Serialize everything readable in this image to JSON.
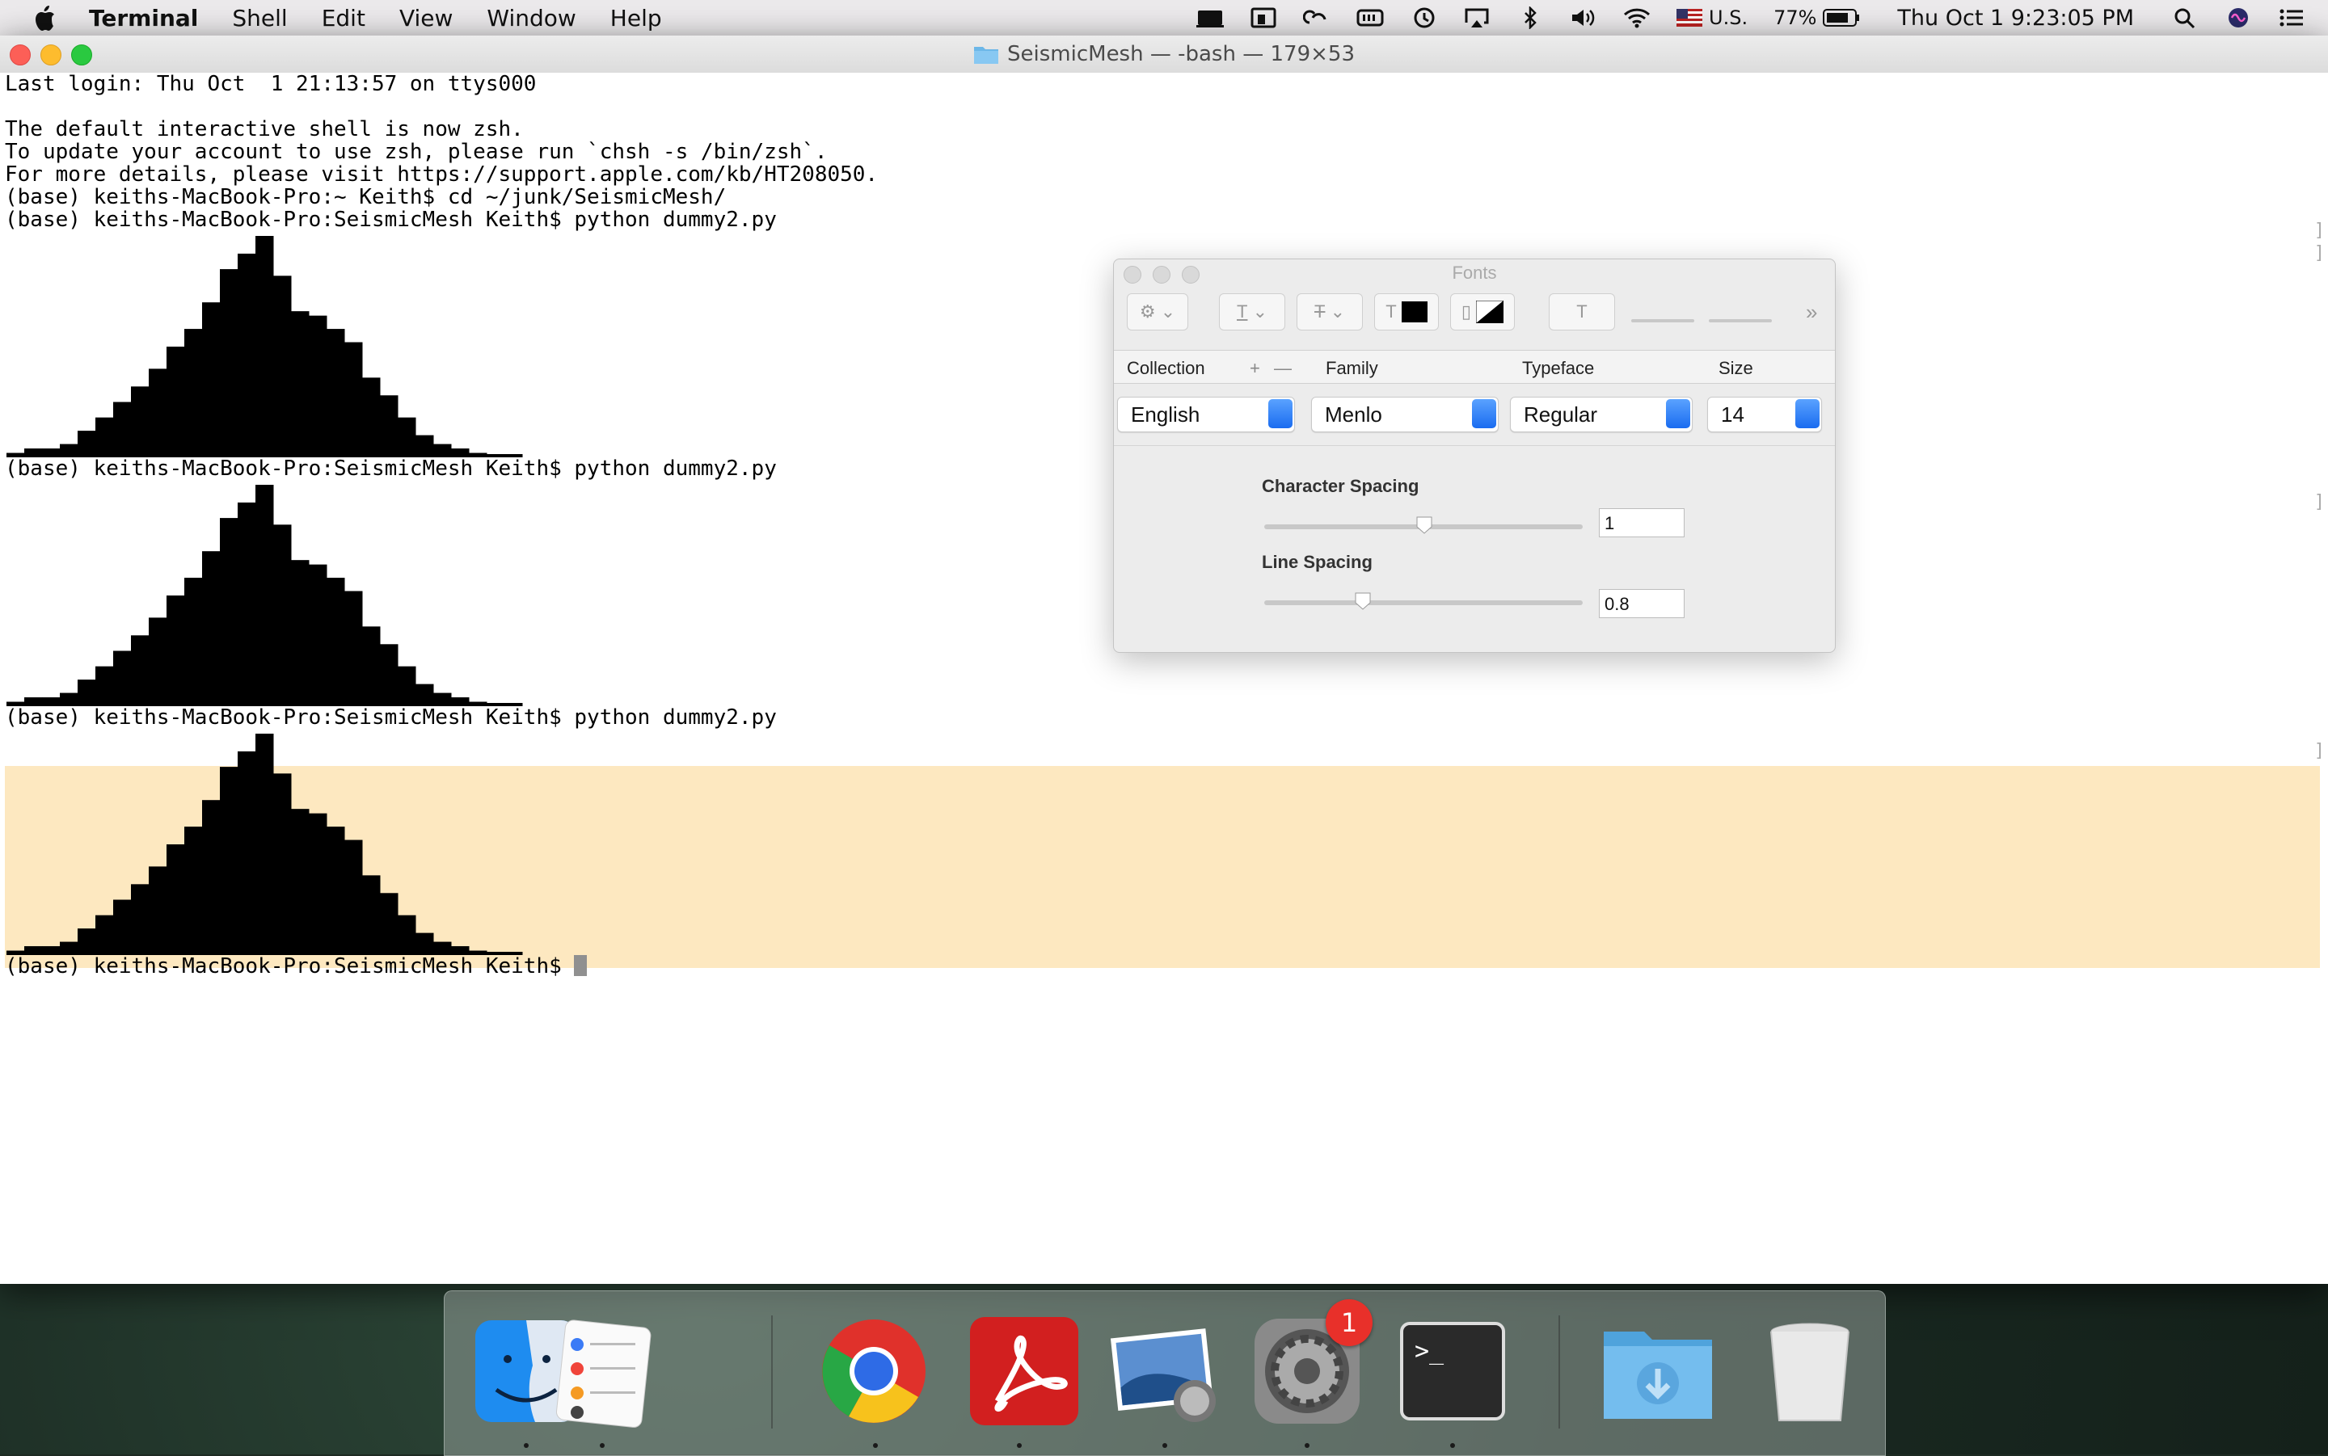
{
  "menubar": {
    "app_name": "Terminal",
    "items": [
      "Shell",
      "Edit",
      "View",
      "Window",
      "Help"
    ],
    "status": {
      "input_source": "U.S.",
      "battery": "77%",
      "clock": "Thu Oct 1  9:23:05 PM"
    },
    "icons": [
      "apple-icon",
      "mirroring-icon",
      "display-icon",
      "creative-cloud-icon",
      "memory-icon",
      "time-machine-icon",
      "airplay-icon",
      "bluetooth-icon",
      "volume-icon",
      "wifi-icon",
      "us-flag-icon",
      "battery-icon",
      "spotlight-icon",
      "siri-icon",
      "notification-center-icon"
    ]
  },
  "window": {
    "title": "SeismicMesh — -bash — 179×53"
  },
  "terminal": {
    "lines": [
      "Last login: Thu Oct  1 21:13:57 on ttys000",
      "",
      "The default interactive shell is now zsh.",
      "To update your account to use zsh, please run `chsh -s /bin/zsh`.",
      "For more details, please visit https://support.apple.com/kb/HT208050.",
      "(base) keiths-MacBook-Pro:~ Keith$ cd ~/junk/SeismicMesh/",
      "(base) keiths-MacBook-Pro:SeismicMesh Keith$ python dummy2.py"
    ],
    "prompt_repeat_1": "(base) keiths-MacBook-Pro:SeismicMesh Keith$ python dummy2.py",
    "prompt_repeat_2": "(base) keiths-MacBook-Pro:SeismicMesh Keith$ python dummy2.py",
    "final_prompt": "(base) keiths-MacBook-Pro:SeismicMesh Keith$ ",
    "histogram_levels": [
      0.02,
      0.04,
      0.04,
      0.06,
      0.12,
      0.18,
      0.25,
      0.32,
      0.4,
      0.5,
      0.58,
      0.7,
      0.85,
      0.92,
      1.0,
      0.82,
      0.66,
      0.64,
      0.58,
      0.52,
      0.36,
      0.28,
      0.18,
      0.1,
      0.06,
      0.04,
      0.02,
      0.01,
      0.01
    ]
  },
  "fonts_panel": {
    "title": "Fonts",
    "headers": {
      "collection": "Collection",
      "family": "Family",
      "typeface": "Typeface",
      "size": "Size"
    },
    "collection_value": "English",
    "family_value": "Menlo",
    "typeface_value": "Regular",
    "size_value": "14",
    "char_spacing_label": "Character Spacing",
    "char_spacing_value": "1",
    "line_spacing_label": "Line Spacing",
    "line_spacing_value": "0.8"
  },
  "dock": {
    "apps": [
      "Finder",
      "Reminders",
      "Google Chrome",
      "Adobe Acrobat",
      "Preview",
      "System Preferences",
      "Terminal",
      "Downloads",
      "Trash"
    ],
    "system_preferences_badge": "1"
  }
}
